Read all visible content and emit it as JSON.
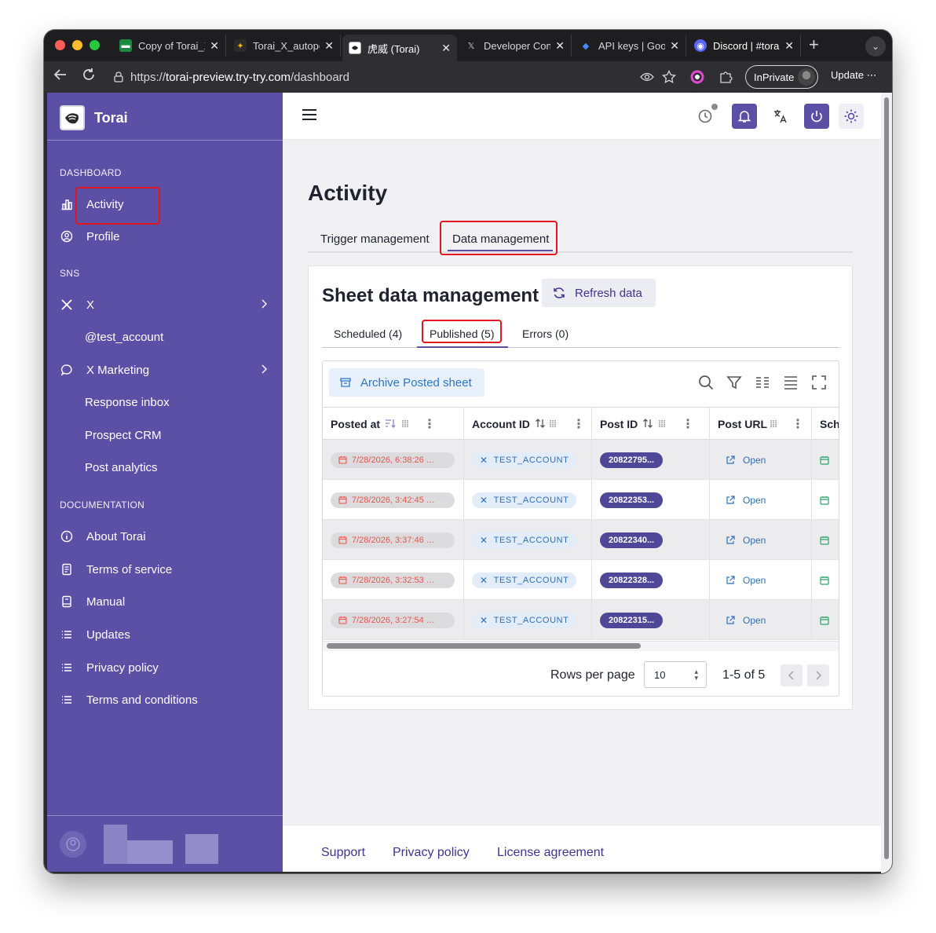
{
  "browser": {
    "tabs": [
      {
        "title": "Copy of Torai_X_A",
        "fav_color": "#1c8a43",
        "fav_glyph": "▬",
        "close": "✕"
      },
      {
        "title": "Torai_X_autopost",
        "fav_color": "#2a2a2a",
        "fav_glyph": "✦",
        "close": "✕"
      },
      {
        "title": "虎威 (Torai)",
        "fav_color": "#ffffff",
        "fav_glyph": "",
        "close": "✕"
      },
      {
        "title": "Developer Console",
        "fav_color": "#2a2a2a",
        "fav_glyph": "𝕏",
        "close": "✕"
      },
      {
        "title": "API keys | Google",
        "fav_color": "#2a2a2a",
        "fav_glyph": "◆",
        "close": "✕"
      },
      {
        "title": "Discord | #torai-",
        "fav_color": "#5865f2",
        "fav_glyph": "◉",
        "close": "✕"
      }
    ],
    "new_tab": "+",
    "tab_menu": "⌄",
    "url_scheme": "https://",
    "url_host": "torai-preview.try-try.com",
    "url_path": "/dashboard",
    "inprivate_label": "InPrivate",
    "update_label": "Update ⋯"
  },
  "sidebar": {
    "app_name": "Torai",
    "sections": {
      "dashboard": "DASHBOARD",
      "sns": "SNS",
      "documentation": "DOCUMENTATION"
    },
    "dashboard_items": [
      {
        "label": "Activity",
        "icon": "bar-chart-icon"
      },
      {
        "label": "Profile",
        "icon": "user-circle-icon"
      }
    ],
    "sns_items": {
      "x": "X",
      "x_account": "@test_account",
      "x_marketing": "X Marketing",
      "x_marketing_sub": [
        "Response inbox",
        "Prospect CRM",
        "Post analytics"
      ]
    },
    "documentation_items": [
      {
        "label": "About Torai",
        "icon": "info-icon"
      },
      {
        "label": "Terms of service",
        "icon": "document-icon"
      },
      {
        "label": "Manual",
        "icon": "book-icon"
      },
      {
        "label": "Updates",
        "icon": "list-icon"
      },
      {
        "label": "Privacy policy",
        "icon": "list-icon"
      },
      {
        "label": "Terms and conditions",
        "icon": "list-icon"
      }
    ]
  },
  "main": {
    "title": "Activity",
    "tabs": [
      "Trigger management",
      "Data management"
    ],
    "card": {
      "title": "Sheet data management",
      "refresh_label": "Refresh data",
      "subtabs": [
        "Scheduled (4)",
        "Published (5)",
        "Errors (0)"
      ],
      "archive_label": "Archive Posted sheet",
      "columns": [
        "Posted at",
        "Account ID",
        "Post ID",
        "Post URL",
        "Sch"
      ],
      "rows": [
        {
          "posted_at": "7/28/2026, 6:38:26 …",
          "account": "TEST_ACCOUNT",
          "post_id": "20822795...",
          "url": "Open"
        },
        {
          "posted_at": "7/28/2026, 3:42:45 …",
          "account": "TEST_ACCOUNT",
          "post_id": "20822353...",
          "url": "Open"
        },
        {
          "posted_at": "7/28/2026, 3:37:46 …",
          "account": "TEST_ACCOUNT",
          "post_id": "20822340...",
          "url": "Open"
        },
        {
          "posted_at": "7/28/2026, 3:32:53 …",
          "account": "TEST_ACCOUNT",
          "post_id": "20822328...",
          "url": "Open"
        },
        {
          "posted_at": "7/28/2026, 3:27:54 …",
          "account": "TEST_ACCOUNT",
          "post_id": "20822315...",
          "url": "Open"
        }
      ],
      "rows_per_page_label": "Rows per page",
      "rows_per_page_value": "10",
      "range_label": "1-5 of 5"
    }
  },
  "footer": {
    "links": [
      "Support",
      "Privacy policy",
      "License agreement"
    ]
  },
  "colors": {
    "sidebar": "#5b50a5",
    "accent": "#5b50a5",
    "highlight": "#e3151f",
    "link": "#2f6fb8"
  }
}
